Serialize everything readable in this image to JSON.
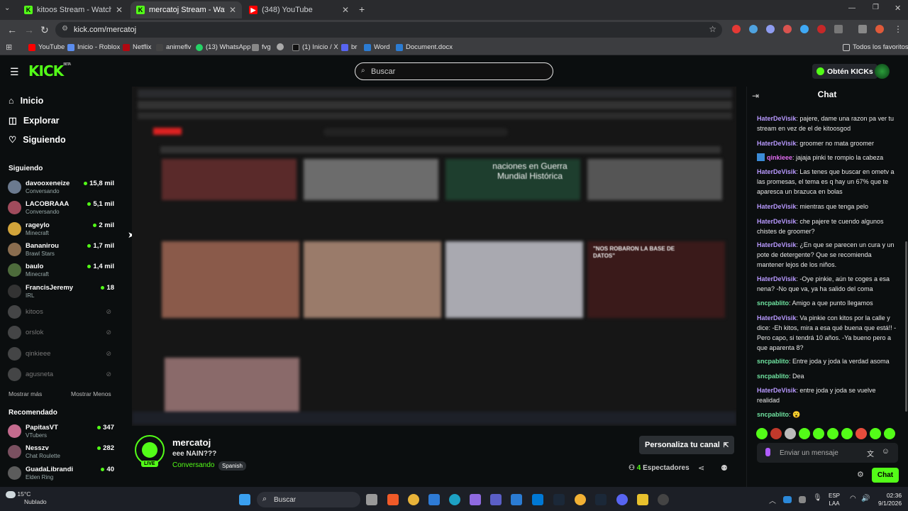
{
  "browser": {
    "tabs": [
      {
        "title": "kitoos Stream - Watch Live on K",
        "favicon": "kick-icon",
        "active": false
      },
      {
        "title": "mercatoj Stream - Watch Live o",
        "favicon": "kick-icon",
        "active": true
      },
      {
        "title": "(348) YouTube",
        "favicon": "youtube-icon",
        "active": false
      }
    ],
    "url": "kick.com/mercatoj",
    "bookmarks": [
      "YouTube",
      "Inicio - Roblox",
      "Netflix",
      "animeflv",
      "(13) WhatsApp",
      "fvg",
      "(1) Inicio / X",
      "br",
      "Word",
      "Document.docx"
    ],
    "all_favorites": "Todos los favoritos"
  },
  "header": {
    "logo": "KICK",
    "logo_badge": "BETA",
    "search_placeholder": "Buscar",
    "get_kicks": "Obtén KICKs"
  },
  "sidebar": {
    "nav": [
      {
        "label": "Inicio",
        "icon": "home-icon"
      },
      {
        "label": "Explorar",
        "icon": "compass-icon"
      },
      {
        "label": "Siguiendo",
        "icon": "heart-icon"
      }
    ],
    "following_title": "Siguiendo",
    "following": [
      {
        "name": "davooxeneize",
        "category": "Conversando",
        "viewers": "15,8 mil",
        "color": "#6b7a8f"
      },
      {
        "name": "LACOBRAAA",
        "category": "Conversando",
        "viewers": "5,1 mil",
        "color": "#a04b5c"
      },
      {
        "name": "rageylo",
        "category": "Minecraft",
        "viewers": "2 mil",
        "color": "#d2a43a"
      },
      {
        "name": "Bananirou",
        "category": "Brawl Stars",
        "viewers": "1,7 mil",
        "color": "#8a6d4f"
      },
      {
        "name": "baulo",
        "category": "Minecraft",
        "viewers": "1,4 mil",
        "color": "#4d6b3b"
      },
      {
        "name": "FrancisJeremy",
        "category": "IRL",
        "viewers": "18",
        "color": "#333333"
      }
    ],
    "offline": [
      "kitoos",
      "orslok",
      "qinkieee",
      "agusneta"
    ],
    "show_more": "Mostrar más",
    "show_less": "Mostrar Menos",
    "recommended_title": "Recomendado",
    "recommended": [
      {
        "name": "PapitasVT",
        "category": "VTubers",
        "viewers": "347",
        "color": "#c46b8e"
      },
      {
        "name": "Nesszv",
        "category": "Chat Roulette",
        "viewers": "282",
        "color": "#7a5060"
      },
      {
        "name": "GuadaLibrandi",
        "category": "Elden Ring",
        "viewers": "40",
        "color": "#5c5c5c"
      }
    ]
  },
  "video": {
    "inner_text": "naciones en Guerra Mundial Histórica",
    "inner_text2": "\"NOS ROBARON LA BASE DE DATOS\""
  },
  "channel": {
    "name": "mercatoj",
    "live": "LIVE",
    "title": "eee NAIN???",
    "category": "Conversando",
    "language": "Spanish",
    "customize": "Personaliza tu canal",
    "viewers_count": "4",
    "viewers_label": "Espectadores"
  },
  "chat": {
    "title": "Chat",
    "messages": [
      {
        "user": "HaterDeVisik",
        "text": "pajere, dame una razon pa ver tu stream en vez de el de kitoosgod",
        "color": "#b899ff"
      },
      {
        "user": "HaterDeVisik",
        "text": "groomer no mata groomer",
        "color": "#b899ff"
      },
      {
        "user": "qinkieee",
        "text": "jajaja pinki te rompio la cabeza",
        "color": "#e06cf0"
      },
      {
        "user": "HaterDeVisik",
        "text": "Las tenes que buscar en ometv a las promesas, el tema es q hay un 67% que te aparesca un brazuca en bolas",
        "color": "#b899ff"
      },
      {
        "user": "HaterDeVisik",
        "text": "mientras que tenga pelo",
        "color": "#b899ff"
      },
      {
        "user": "HaterDeVisik",
        "text": "che pajere te cuendo algunos chistes de groomer?",
        "color": "#b899ff"
      },
      {
        "user": "HaterDeVisik",
        "text": "¿En que se parecen un cura y un pote de detergente? Que se recomienda mantener lejos de los niños.",
        "color": "#b899ff"
      },
      {
        "user": "HaterDeVisik",
        "text": "-Oye pinkie, aún te coges a esa nena? -No que va, ya ha salido del coma",
        "color": "#b899ff"
      },
      {
        "user": "sncpablito",
        "text": "Amigo a que punto llegamos",
        "color": "#6fe3a0"
      },
      {
        "user": "HaterDeVisik",
        "text": "Va pinkie con kitos por la calle y dice: -Eh kitos, mira a esa qué buena que está!! -Pero capo, si tendrá 10 años. -Ya bueno pero a que aparenta 8?",
        "color": "#b899ff"
      },
      {
        "user": "sncpablito",
        "text": "Entre joda y joda la verdad asoma",
        "color": "#6fe3a0"
      },
      {
        "user": "sncpablito",
        "text": "Dea",
        "color": "#6fe3a0"
      },
      {
        "user": "HaterDeVisik",
        "text": "entre joda y joda se vuelve realidad",
        "color": "#b899ff"
      },
      {
        "user": "sncpablito",
        "text": "😮",
        "color": "#6fe3a0"
      }
    ],
    "input_placeholder": "Enviar un mensaje",
    "send": "Chat"
  },
  "taskbar": {
    "temperature": "15°C",
    "weather": "Nublado",
    "search": "Buscar",
    "lang1": "ESP",
    "lang2": "LAA",
    "time": "02:36",
    "date": "9/1/2026"
  }
}
